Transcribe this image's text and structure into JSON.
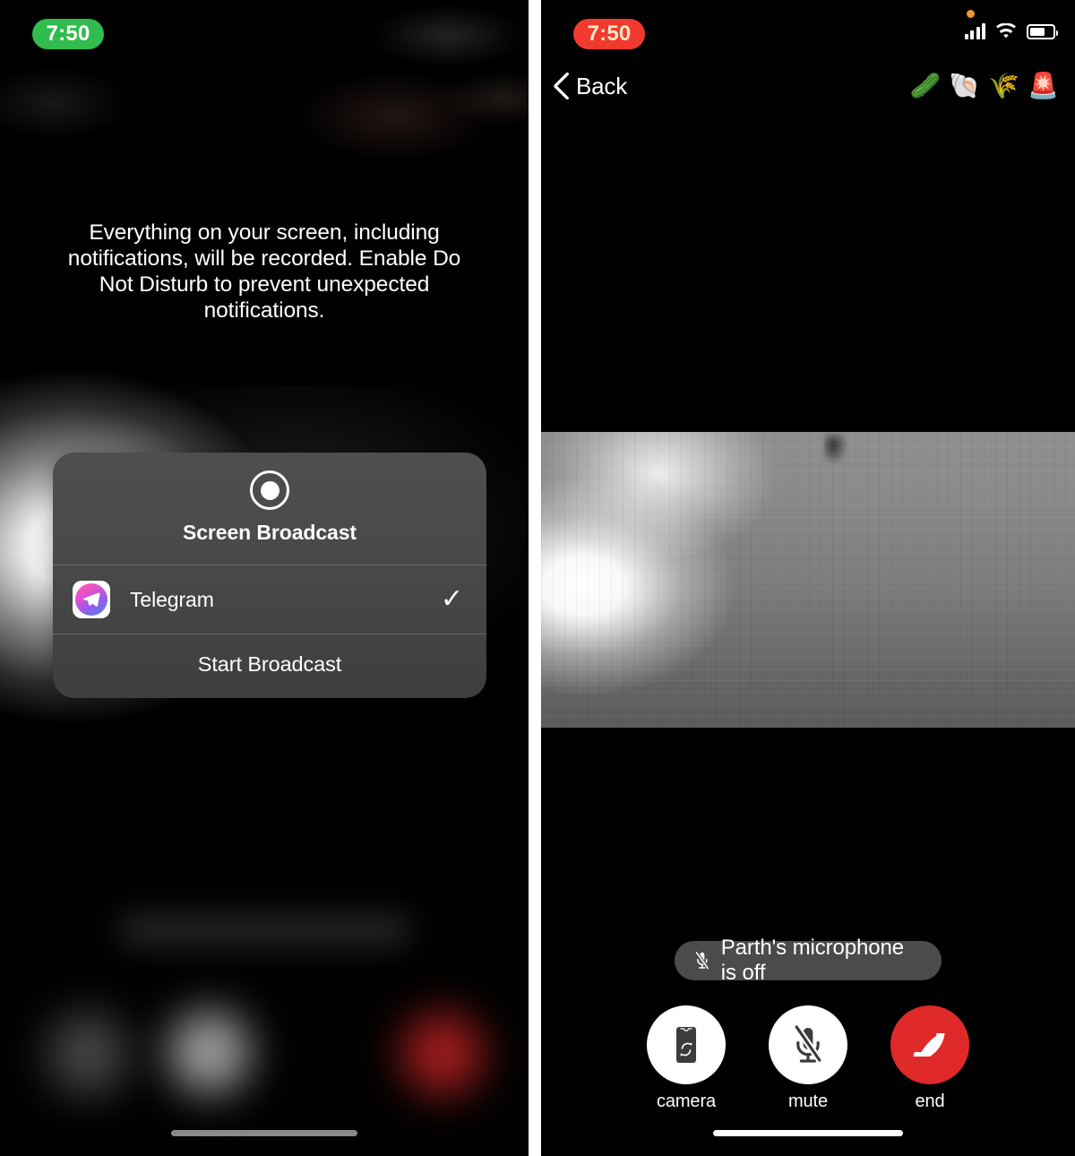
{
  "left_panel": {
    "status_bar": {
      "time": "7:50",
      "time_pill_color": "#30bc4e",
      "time_text_color": "#ffffff"
    },
    "notice": "Everything on your screen, including notifications, will be recorded. Enable Do Not Disturb to prevent unexpected notifications.",
    "broadcast_sheet": {
      "icon": "record-icon",
      "title": "Screen Broadcast",
      "app_row": {
        "app_name": "Telegram",
        "app_icon": "telegram-icon",
        "selected": true,
        "check_glyph": "✓"
      },
      "action_label": "Start Broadcast"
    }
  },
  "right_panel": {
    "status_bar": {
      "time": "7:50",
      "time_pill_color": "#f03a2e",
      "time_text_color": "#fbe7c8",
      "recording_dot_color": "#f0952a",
      "icons": [
        "cellular-signal-icon",
        "wifi-icon",
        "battery-icon"
      ]
    },
    "nav": {
      "back_label": "Back",
      "back_icon": "chevron-left-icon",
      "emojis": [
        "🥒",
        "🐚",
        "🌾",
        "🚨"
      ]
    },
    "video": {
      "description": "grayscale-video-feed"
    },
    "mic_status": {
      "icon": "microphone-off-icon",
      "text": "Parth's microphone is off"
    },
    "controls": [
      {
        "label": "camera",
        "icon": "flip-camera-icon",
        "style": "light"
      },
      {
        "label": "mute",
        "icon": "microphone-off-icon",
        "style": "light"
      },
      {
        "label": "end",
        "icon": "end-call-icon",
        "style": "danger",
        "color": "#e02929"
      }
    ]
  }
}
